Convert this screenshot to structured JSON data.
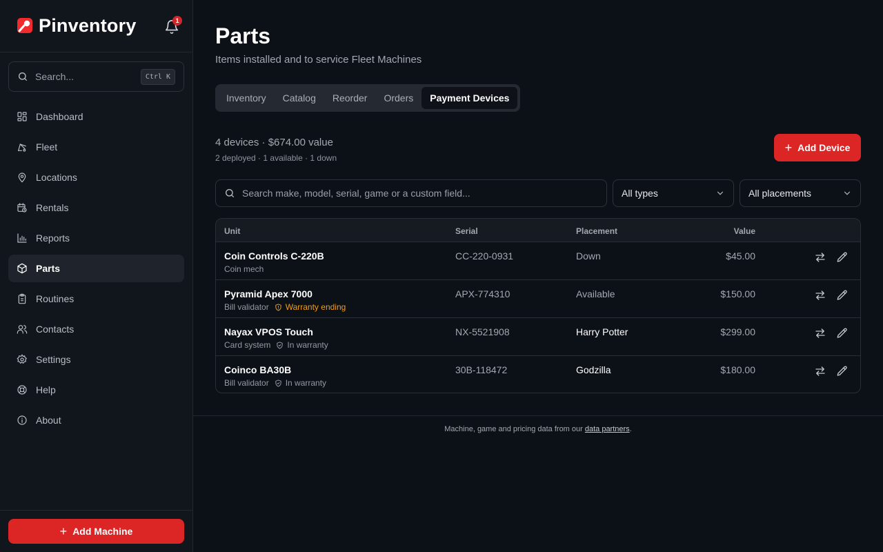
{
  "app": {
    "name": "Pinventory",
    "notification_count": "1"
  },
  "sidebar": {
    "search_placeholder": "Search...",
    "search_shortcut": "Ctrl K",
    "items": [
      {
        "label": "Dashboard",
        "icon": "dashboard-icon"
      },
      {
        "label": "Fleet",
        "icon": "pinball-icon"
      },
      {
        "label": "Locations",
        "icon": "map-pin-icon"
      },
      {
        "label": "Rentals",
        "icon": "calendar-clock-icon"
      },
      {
        "label": "Reports",
        "icon": "bar-chart-icon"
      },
      {
        "label": "Parts",
        "icon": "package-icon",
        "active": true
      },
      {
        "label": "Routines",
        "icon": "clipboard-icon"
      },
      {
        "label": "Contacts",
        "icon": "users-icon"
      },
      {
        "label": "Settings",
        "icon": "gear-icon"
      },
      {
        "label": "Help",
        "icon": "life-buoy-icon"
      },
      {
        "label": "About",
        "icon": "info-icon"
      }
    ],
    "add_machine_label": "Add Machine"
  },
  "page": {
    "title": "Parts",
    "subtitle": "Items installed and to service Fleet Machines",
    "tabs": [
      "Inventory",
      "Catalog",
      "Reorder",
      "Orders",
      "Payment Devices"
    ],
    "active_tab": "Payment Devices",
    "summary": "4 devices · $674.00 value",
    "summary_sub": "2 deployed · 1 available · 1 down",
    "add_device_label": "Add Device",
    "search_placeholder": "Search make, model, serial, game or a custom field...",
    "type_filter": "All types",
    "placement_filter": "All placements"
  },
  "table": {
    "columns": {
      "unit": "Unit",
      "serial": "Serial",
      "placement": "Placement",
      "value": "Value"
    },
    "rows": [
      {
        "name": "Coin Controls C-220B",
        "type": "Coin mech",
        "warranty": "",
        "serial": "CC-220-0931",
        "placement": "Down",
        "value": "$45.00"
      },
      {
        "name": "Pyramid Apex 7000",
        "type": "Bill validator",
        "warranty": "Warranty ending",
        "serial": "APX-774310",
        "placement": "Available",
        "value": "$150.00"
      },
      {
        "name": "Nayax VPOS Touch",
        "type": "Card system",
        "warranty": "In warranty",
        "serial": "NX-5521908",
        "placement": "Harry Potter",
        "value": "$299.00"
      },
      {
        "name": "Coinco BA30B",
        "type": "Bill validator",
        "warranty": "In warranty",
        "serial": "30B-118472",
        "placement": "Godzilla",
        "value": "$180.00"
      }
    ]
  },
  "footer": {
    "text": "Machine, game and pricing data from our",
    "link": "data partners",
    "end": "."
  },
  "colors": {
    "accent": "#dc2626",
    "warning": "#f59e0b",
    "background": "#0c1017",
    "sidebar": "#11151c"
  }
}
